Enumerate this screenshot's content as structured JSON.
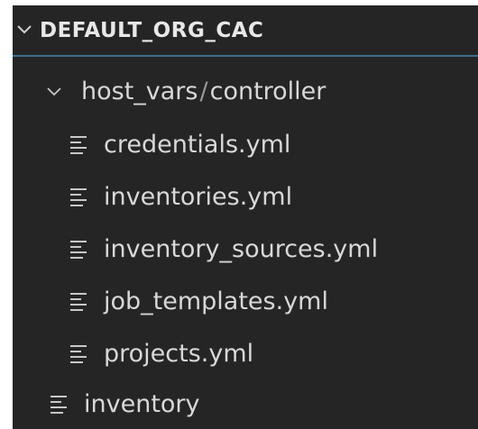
{
  "explorer": {
    "root": {
      "label": "DEFAULT_ORG_CAC",
      "expanded": true
    },
    "folder": {
      "name": "host_vars",
      "separator": "/",
      "subfolder": "controller",
      "expanded": true,
      "files": [
        {
          "label": "credentials.yml"
        },
        {
          "label": "inventories.yml"
        },
        {
          "label": "inventory_sources.yml"
        },
        {
          "label": "job_templates.yml"
        },
        {
          "label": "projects.yml"
        }
      ]
    },
    "root_files": [
      {
        "label": "inventory"
      }
    ]
  },
  "colors": {
    "background": "#252526",
    "text": "#d8d8d8",
    "accent_border": "#3b6e8f"
  },
  "icons": {
    "chevron": "chevron-down-icon",
    "file": "file-lines-icon"
  }
}
